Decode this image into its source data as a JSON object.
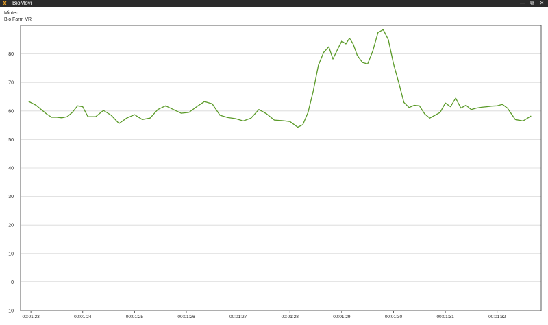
{
  "window": {
    "title": "BioMovi",
    "icons": [
      "app-icon",
      "minimize-icon",
      "restore-icon",
      "close-icon"
    ],
    "icon_glyphs": {
      "app": "X",
      "minimize": "—",
      "restore": "⧉",
      "close": "✕"
    }
  },
  "header": {
    "line1": "Miotec",
    "line2": "Bio Farm VR"
  },
  "chart_data": {
    "type": "line",
    "title": "",
    "xlabel": "",
    "ylabel": "",
    "ylim": [
      -10,
      90
    ],
    "y_ticks": [
      -10,
      0,
      10,
      20,
      30,
      40,
      50,
      60,
      70,
      80
    ],
    "x_ticks": [
      "00:01:23",
      "00:01:24",
      "00:01:25",
      "00:01:26",
      "00:01:27",
      "00:01:28",
      "00:01:29",
      "00:01:30",
      "00:01:31",
      "00:01:32"
    ],
    "grid": true,
    "colors": {
      "line": "#5a9a28",
      "grid": "#d8d8d8",
      "zero_line": "#333333",
      "axis": "#333333"
    },
    "series": [
      {
        "x": [
          82.96,
          83.1,
          83.2,
          83.3,
          83.4,
          83.5,
          83.6,
          83.7,
          83.8,
          83.9,
          84.0,
          84.1,
          84.25,
          84.4,
          84.55,
          84.7,
          84.85,
          85.0,
          85.15,
          85.3,
          85.45,
          85.6,
          85.75,
          85.9,
          86.05,
          86.2,
          86.35,
          86.5,
          86.65,
          86.8,
          86.95,
          87.1,
          87.25,
          87.4,
          87.55,
          87.7,
          87.85,
          88.0,
          88.15,
          88.25,
          88.35,
          88.45,
          88.55,
          88.65,
          88.75,
          88.83,
          88.93,
          89.0,
          89.08,
          89.15,
          89.22,
          89.3,
          89.4,
          89.5,
          89.6,
          89.7,
          89.8,
          89.9,
          90.0,
          90.1,
          90.2,
          90.3,
          90.4,
          90.5,
          90.6,
          90.7,
          90.8,
          90.9,
          91.0,
          91.1,
          91.2,
          91.3,
          91.4,
          91.5,
          91.6,
          91.7,
          91.8,
          91.9,
          92.0,
          92.1,
          92.2,
          92.35,
          92.5,
          92.65
        ],
        "y": [
          63.3,
          62.0,
          60.5,
          59.0,
          57.8,
          57.8,
          57.6,
          58.0,
          59.5,
          61.8,
          61.5,
          58.0,
          58.0,
          60.2,
          58.5,
          55.6,
          57.5,
          58.7,
          57.0,
          57.5,
          60.5,
          61.8,
          60.5,
          59.2,
          59.5,
          61.5,
          63.3,
          62.5,
          58.5,
          57.7,
          57.3,
          56.5,
          57.5,
          60.5,
          59.0,
          56.8,
          56.6,
          56.3,
          54.3,
          55.2,
          59.5,
          67.0,
          76.0,
          80.5,
          82.5,
          78.2,
          82.0,
          84.5,
          83.5,
          85.5,
          83.5,
          79.5,
          77.0,
          76.5,
          81.0,
          87.5,
          88.5,
          85.0,
          76.5,
          70.0,
          63.0,
          61.2,
          62.0,
          61.8,
          59.0,
          57.5,
          58.5,
          59.5,
          62.8,
          61.5,
          64.5,
          61.0,
          62.0,
          60.5,
          61.0,
          61.3,
          61.5,
          61.7,
          61.8,
          62.3,
          61.0,
          57.0,
          56.5,
          58.2
        ]
      }
    ]
  }
}
